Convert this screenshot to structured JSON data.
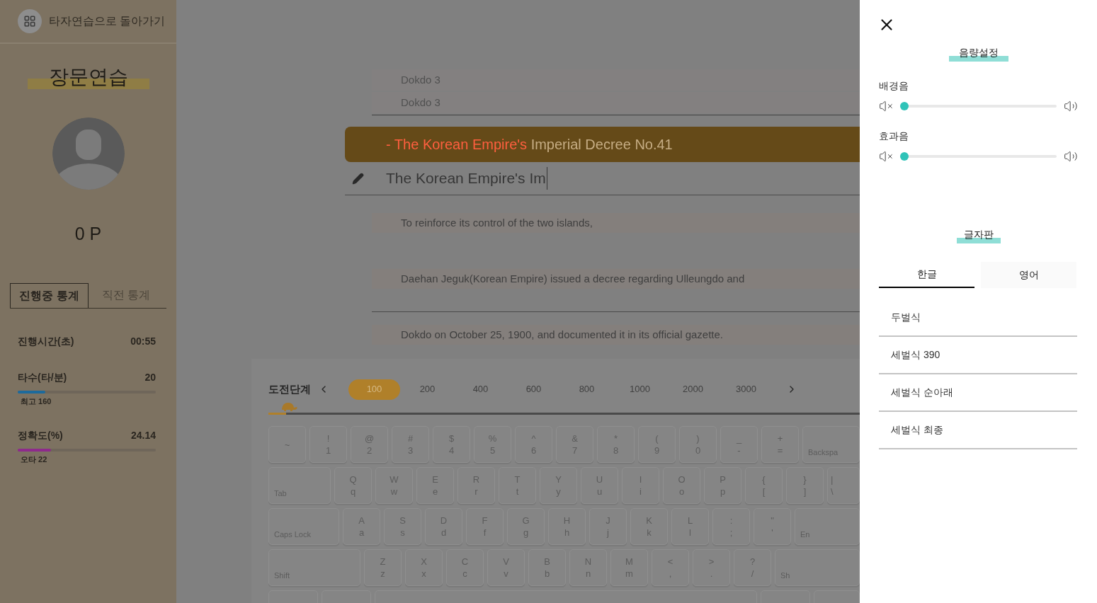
{
  "sidebar": {
    "back_link": "타자연습으로 돌아가기",
    "title": "장문연습",
    "points": "0 P",
    "tabs": [
      {
        "label": "진행중 통계",
        "selected": true
      },
      {
        "label": "직전 통계",
        "selected": false
      }
    ],
    "stats": [
      {
        "kind": "plain",
        "label": "진행시간(초)",
        "value": "00:55"
      },
      {
        "kind": "bar",
        "label": "타수(타/분)",
        "value": "20",
        "level": 0.2,
        "color": "#1d6a9c",
        "note": "최고 160"
      },
      {
        "kind": "bar",
        "label": "정확도(%)",
        "value": "24.14",
        "level": 0.24,
        "color": "#8e2a8c",
        "note": "오타 22"
      }
    ]
  },
  "practice": {
    "previous_lines": [
      "Dokdo 3",
      "Dokdo 3"
    ],
    "current": {
      "typed_part": "- The Korean Empire's",
      "rest": "Imperial Decree No.41"
    },
    "input": {
      "value": "The Korean Empire's Im"
    },
    "upcoming_groups": [
      [
        "To reinforce its control of the two islands,",
        "Daehan Jeguk(Korean Empire) issued a decree regarding Ulleungdo and"
      ],
      [
        "Dokdo on October 25, 1900, and documented it in its official gazette."
      ]
    ]
  },
  "stage": {
    "label": "도전단계",
    "levels": [
      {
        "label": "100",
        "selected": true
      },
      {
        "label": "200",
        "selected": false
      },
      {
        "label": "400",
        "selected": false
      },
      {
        "label": "600",
        "selected": false
      },
      {
        "label": "800",
        "selected": false
      },
      {
        "label": "1000",
        "selected": false
      },
      {
        "label": "2000",
        "selected": false
      },
      {
        "label": "3000",
        "selected": false
      }
    ],
    "progress": {
      "level": 0.03
    }
  },
  "keyboard": [
    [
      {
        "kind": "char",
        "upper": "~"
      },
      {
        "kind": "char",
        "upper": "!",
        "lower": "1"
      },
      {
        "kind": "char",
        "upper": "@",
        "lower": "2"
      },
      {
        "kind": "char",
        "upper": "#",
        "lower": "3"
      },
      {
        "kind": "char",
        "upper": "$",
        "lower": "4"
      },
      {
        "kind": "char",
        "upper": "%",
        "lower": "5"
      },
      {
        "kind": "char",
        "upper": "^",
        "lower": "6"
      },
      {
        "kind": "char",
        "upper": "&",
        "lower": "7"
      },
      {
        "kind": "char",
        "upper": "*",
        "lower": "8"
      },
      {
        "kind": "char",
        "upper": "(",
        "lower": "9"
      },
      {
        "kind": "char",
        "upper": ")",
        "lower": "0"
      },
      {
        "kind": "char",
        "upper": "_",
        "lower": "-"
      },
      {
        "kind": "char",
        "upper": "+",
        "lower": "="
      },
      {
        "kind": "end",
        "label": "Backspa"
      }
    ],
    [
      {
        "kind": "tab",
        "label": "Tab"
      },
      {
        "kind": "char",
        "upper": "Q",
        "lower": "q"
      },
      {
        "kind": "char",
        "upper": "W",
        "lower": "w"
      },
      {
        "kind": "char",
        "upper": "E",
        "lower": "e"
      },
      {
        "kind": "char",
        "upper": "R",
        "lower": "r"
      },
      {
        "kind": "char",
        "upper": "T",
        "lower": "t"
      },
      {
        "kind": "char",
        "upper": "Y",
        "lower": "y"
      },
      {
        "kind": "char",
        "upper": "U",
        "lower": "u"
      },
      {
        "kind": "char",
        "upper": "I",
        "lower": "i"
      },
      {
        "kind": "char",
        "upper": "O",
        "lower": "o"
      },
      {
        "kind": "char",
        "upper": "P",
        "lower": "p"
      },
      {
        "kind": "char",
        "upper": "{",
        "lower": "["
      },
      {
        "kind": "char",
        "upper": "}",
        "lower": "]"
      },
      {
        "kind": "end_char",
        "upper": "|",
        "lower": "\\"
      }
    ],
    [
      {
        "kind": "caps",
        "label": "Caps Lock"
      },
      {
        "kind": "char",
        "upper": "A",
        "lower": "a"
      },
      {
        "kind": "char",
        "upper": "S",
        "lower": "s"
      },
      {
        "kind": "char",
        "upper": "D",
        "lower": "d"
      },
      {
        "kind": "char",
        "upper": "F",
        "lower": "f"
      },
      {
        "kind": "char",
        "upper": "G",
        "lower": "g"
      },
      {
        "kind": "char",
        "upper": "H",
        "lower": "h"
      },
      {
        "kind": "char",
        "upper": "J",
        "lower": "j"
      },
      {
        "kind": "char",
        "upper": "K",
        "lower": "k"
      },
      {
        "kind": "char",
        "upper": "L",
        "lower": "l"
      },
      {
        "kind": "char",
        "upper": ":",
        "lower": ";"
      },
      {
        "kind": "char",
        "upper": "\"",
        "lower": "'"
      },
      {
        "kind": "end",
        "label": "En"
      }
    ],
    [
      {
        "kind": "shift",
        "label": "Shift"
      },
      {
        "kind": "char",
        "upper": "Z",
        "lower": "z"
      },
      {
        "kind": "char",
        "upper": "X",
        "lower": "x"
      },
      {
        "kind": "char",
        "upper": "C",
        "lower": "c"
      },
      {
        "kind": "char",
        "upper": "V",
        "lower": "v"
      },
      {
        "kind": "char",
        "upper": "B",
        "lower": "b"
      },
      {
        "kind": "char",
        "upper": "N",
        "lower": "n"
      },
      {
        "kind": "char",
        "upper": "M",
        "lower": "m"
      },
      {
        "kind": "char",
        "upper": "<",
        "lower": ","
      },
      {
        "kind": "char",
        "upper": ">",
        "lower": "."
      },
      {
        "kind": "char",
        "upper": "?",
        "lower": "/"
      },
      {
        "kind": "end",
        "label": "Sh"
      }
    ]
  ],
  "settings": {
    "volume_title": "음량설정",
    "volumes": [
      {
        "label": "배경음",
        "level": 0
      },
      {
        "label": "효과음",
        "level": 0
      }
    ],
    "layout_title": "글자판",
    "layout_tabs": [
      {
        "label": "한글",
        "selected": true
      },
      {
        "label": "영어",
        "selected": false
      }
    ],
    "layouts": [
      "두벌식",
      "세벌식 390",
      "세벌식 순아래",
      "세벌식 최종"
    ]
  }
}
